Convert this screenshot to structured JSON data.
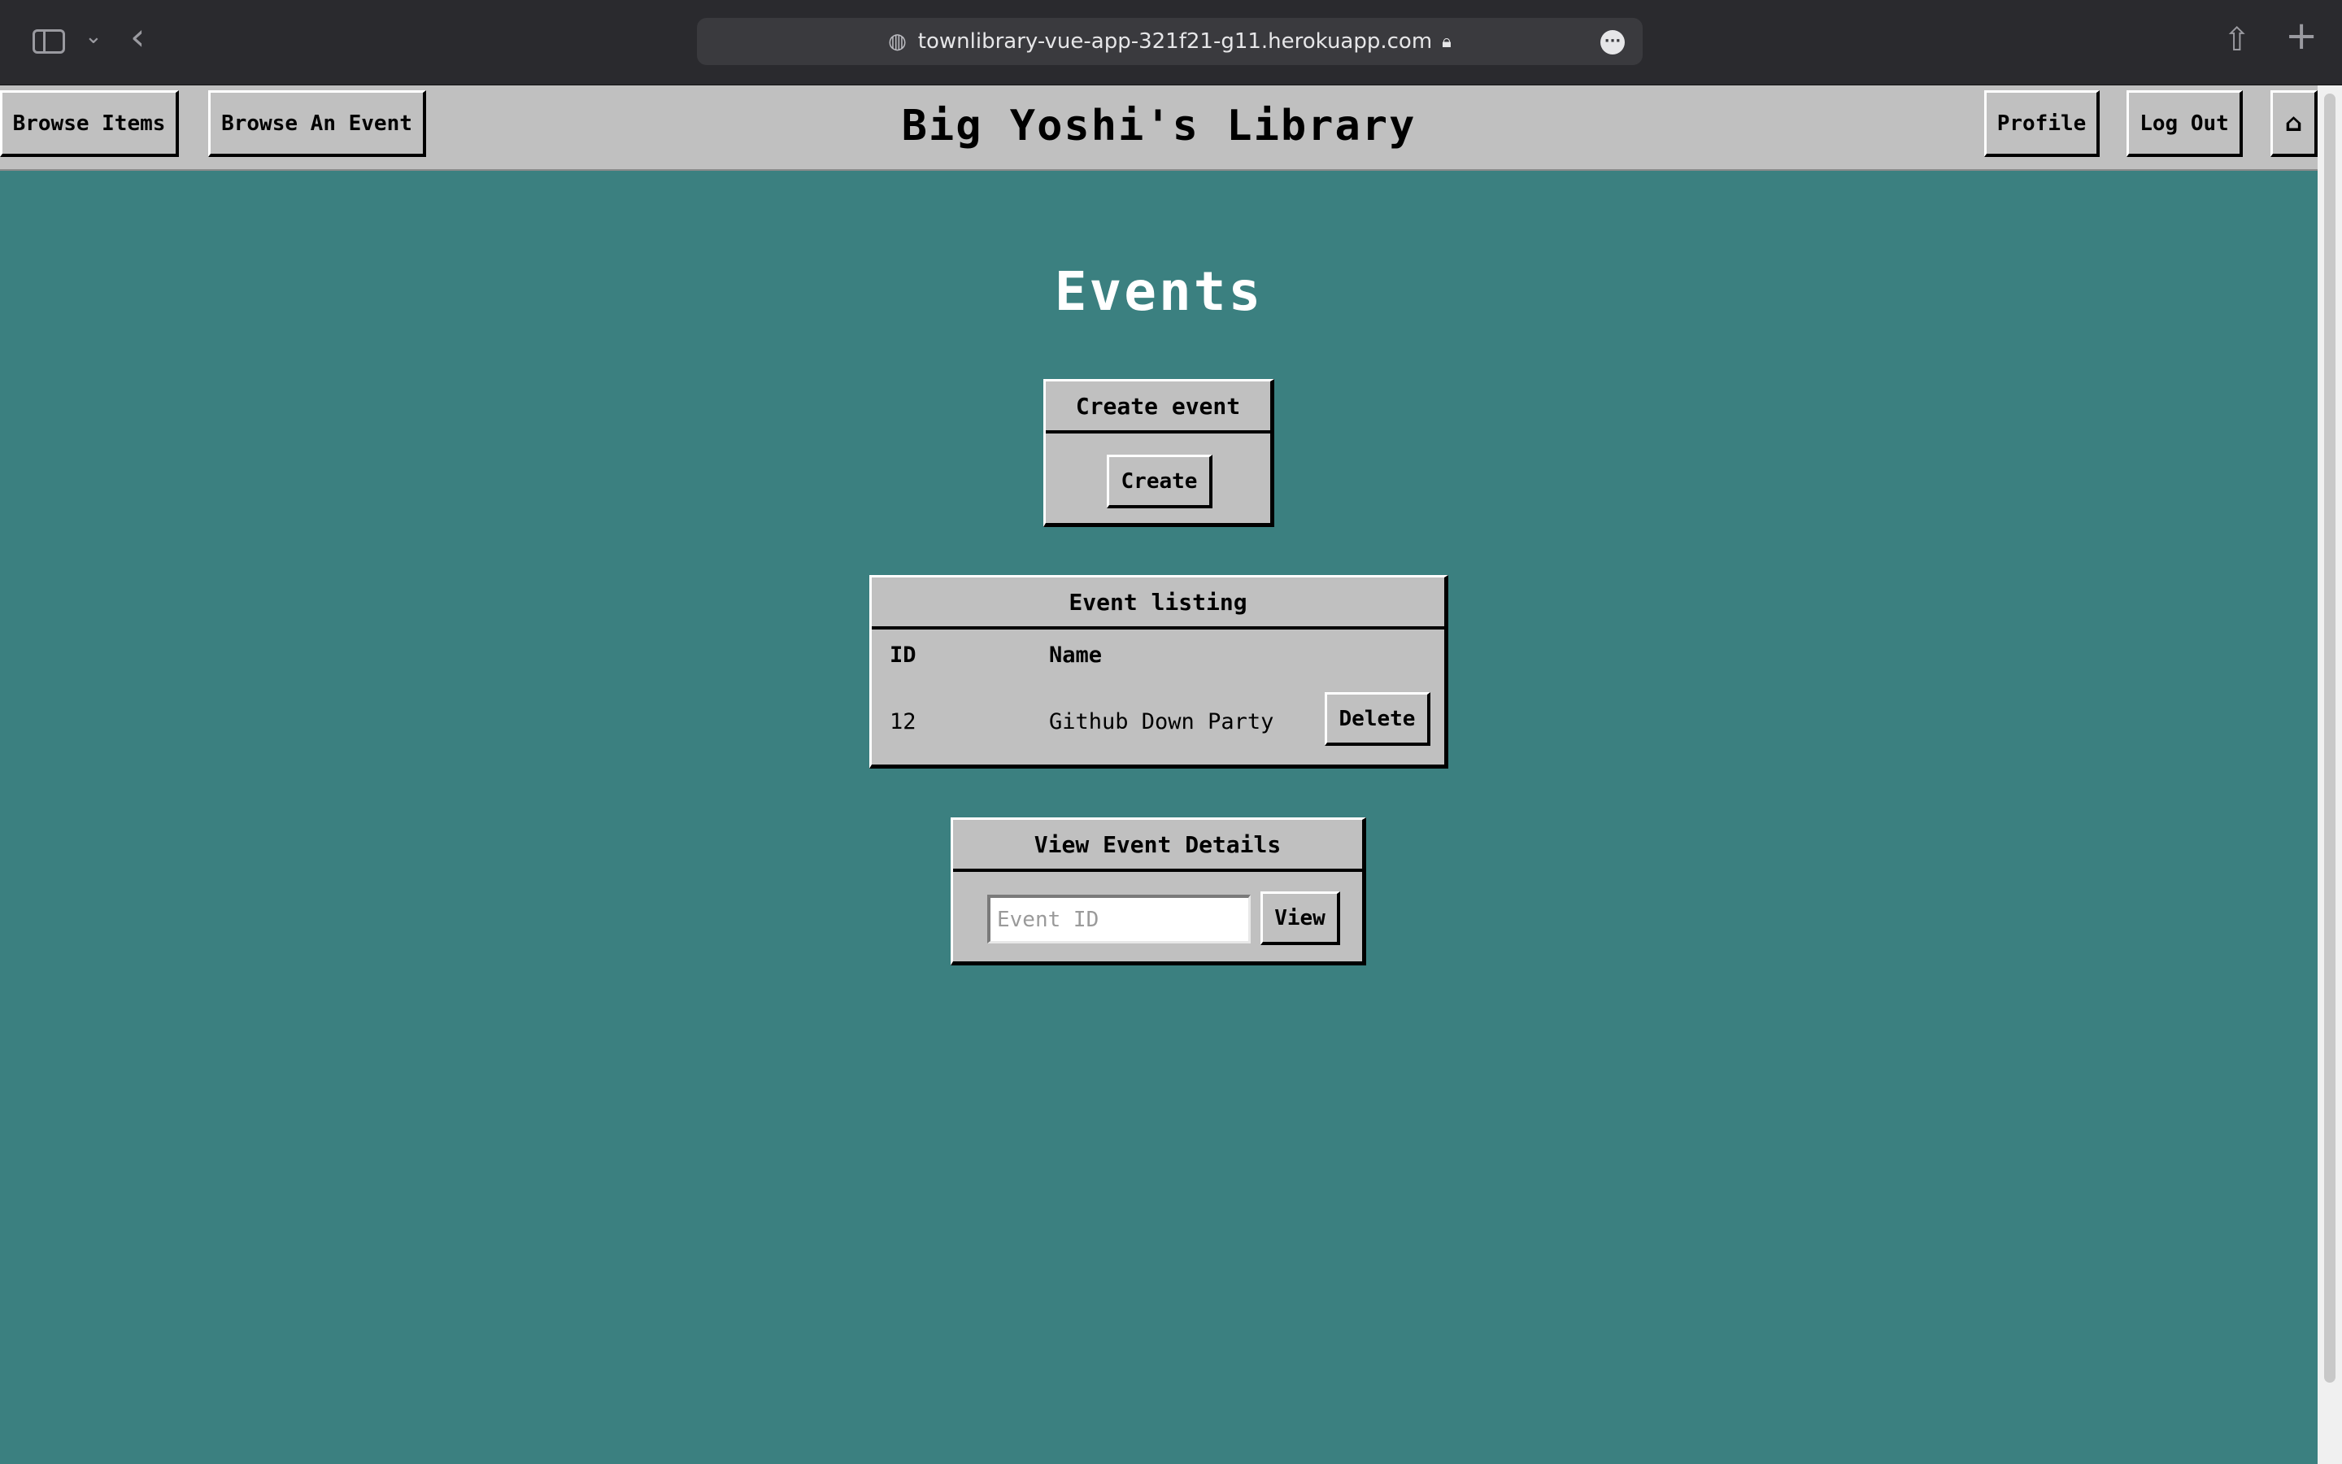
{
  "browser": {
    "url": "townlibrary-vue-app-321f21-g11.herokuapp.com"
  },
  "nav": {
    "browse_items": "Browse Items",
    "browse_event": "Browse An Event",
    "title": "Big Yoshi's Library",
    "profile": "Profile",
    "logout": "Log Out",
    "home_icon": "home-icon"
  },
  "page": {
    "heading": "Events"
  },
  "create_panel": {
    "title": "Create event",
    "button": "Create"
  },
  "listing_panel": {
    "title": "Event listing",
    "columns": [
      "ID",
      "Name"
    ],
    "rows": [
      {
        "id": "12",
        "name": "Github Down Party",
        "action": "Delete"
      }
    ]
  },
  "view_panel": {
    "title": "View Event Details",
    "input_placeholder": "Event ID",
    "input_value": "",
    "button": "View"
  },
  "colors": {
    "background": "#3b8080",
    "panel": "#c0c0c0"
  }
}
